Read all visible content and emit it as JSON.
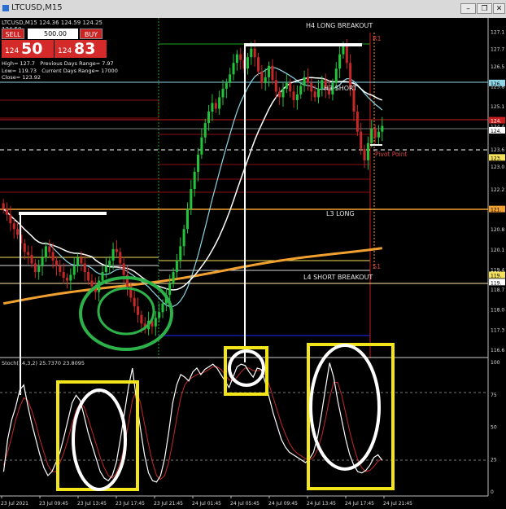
{
  "window": {
    "title": "LTCUSD,M15"
  },
  "trade_panel": {
    "symbol_bar": "LTCUSD,M15  124.36 124.59 124.25 124.50",
    "sell_label": "SELL",
    "buy_label": "BUY",
    "volume": "500.00",
    "sell_small": "124",
    "sell_big": "50",
    "buy_small": "124",
    "buy_big": "83"
  },
  "info": {
    "high": "High= 127.7",
    "low": "Low= 119.73",
    "close": "Close= 123.92",
    "prev_range": "Previous Days Range= 7.97",
    "curr_range": "Current Days Range= 17000"
  },
  "stoch_label": "Stoch(14,3,2) 25.7370 23.8095",
  "chart_data": {
    "type": "candlestick",
    "symbol": "LTCUSD",
    "timeframe": "M15",
    "price_axis": {
      "ticks": [
        "127.1",
        "127.7",
        "126.5",
        "125.8",
        "125.1",
        "124.4",
        "123.6",
        "123.0",
        "122.2",
        "121.5",
        "120.8",
        "120.1",
        "119.4",
        "118.7",
        "118.0",
        "117.3",
        "116.6"
      ],
      "ylim": [
        116.4,
        128.0
      ]
    },
    "price_markers": [
      {
        "label": "126.",
        "value": 125.9,
        "color": "#8fd6e8"
      },
      {
        "label": "124.",
        "value": 124.6,
        "color": "#c81e1e"
      },
      {
        "label": "124.",
        "value": 124.25,
        "color": "#ffffff"
      },
      {
        "label": "123.",
        "value": 123.3,
        "color": "#f5e15b"
      },
      {
        "label": "121.",
        "value": 121.5,
        "color": "#f0a030"
      },
      {
        "label": "119.",
        "value": 119.2,
        "color": "#f5e15b"
      },
      {
        "label": "119.",
        "value": 118.95,
        "color": "#ffffff"
      }
    ],
    "x_ticks": [
      "23 Jul 2021",
      "23 Jul 09:45",
      "23 Jul 13:45",
      "23 Jul 17:45",
      "23 Jul 21:45",
      "24 Jul 01:45",
      "24 Jul 05:45",
      "24 Jul 09:45",
      "24 Jul 13:45",
      "24 Jul 17:45",
      "24 Jul 21:45"
    ],
    "levels": [
      {
        "label": "H4 LONG BREAKOUT",
        "value": 127.6
      },
      {
        "label": "H3 SHORT",
        "value": 125.85
      },
      {
        "label": "Pivot Point",
        "value": 123.3
      },
      {
        "label": "L3 LONG",
        "value": 121.5
      },
      {
        "label": "L4 SHORT BREAKOUT",
        "value": 118.95
      },
      {
        "label": "R1",
        "value": 127.5
      },
      {
        "label": "S1",
        "value": 119.2
      }
    ],
    "closes": [
      121.5,
      121.3,
      121.0,
      120.8,
      120.6,
      120.3,
      120.0,
      119.9,
      119.6,
      119.3,
      119.5,
      119.8,
      120.2,
      120.0,
      119.7,
      119.5,
      119.3,
      119.1,
      119.0,
      119.2,
      119.5,
      119.8,
      119.6,
      119.3,
      119.0,
      118.8,
      118.6,
      119.0,
      119.3,
      119.5,
      119.7,
      120.1,
      120.0,
      119.6,
      119.2,
      118.8,
      118.4,
      118.1,
      117.8,
      117.5,
      117.3,
      117.6,
      117.4,
      117.7,
      117.9,
      118.2,
      118.5,
      118.9,
      119.3,
      119.7,
      120.2,
      120.8,
      121.5,
      122.2,
      122.8,
      123.4,
      124.0,
      124.5,
      124.9,
      125.2,
      125.0,
      125.4,
      125.7,
      125.9,
      126.2,
      126.6,
      126.9,
      126.7,
      126.4,
      126.8,
      127.1,
      126.8,
      126.3,
      125.9,
      126.1,
      126.5,
      126.0,
      125.6,
      125.4,
      125.7,
      125.9,
      125.6,
      125.3,
      125.5,
      125.8,
      126.1,
      125.9,
      125.6,
      125.4,
      125.7,
      126.0,
      125.7,
      125.5,
      125.9,
      126.4,
      126.9,
      127.2,
      126.6,
      125.7,
      124.9,
      124.2,
      123.6,
      123.2,
      123.8,
      124.3,
      124.0,
      124.2,
      124.4
    ],
    "stoch_axis": {
      "ticks": [
        "100",
        "75",
        "50",
        "25",
        "0"
      ],
      "ylim": [
        0,
        100
      ]
    },
    "stoch_main": [
      15,
      40,
      55,
      65,
      78,
      82,
      66,
      52,
      40,
      28,
      18,
      12,
      15,
      22,
      30,
      42,
      55,
      68,
      74,
      70,
      58,
      45,
      35,
      25,
      15,
      10,
      8,
      12,
      22,
      40,
      60,
      80,
      95,
      70,
      48,
      28,
      14,
      8,
      7,
      12,
      25,
      45,
      68,
      82,
      90,
      88,
      85,
      92,
      95,
      90,
      94,
      96,
      98,
      95,
      90,
      85,
      80,
      88,
      96,
      98,
      97,
      92,
      88,
      95,
      94,
      84,
      72,
      60,
      50,
      40,
      34,
      30,
      28,
      26,
      24,
      22,
      25,
      30,
      42,
      60,
      80,
      99,
      88,
      70,
      55,
      40,
      28,
      20,
      15,
      14,
      16,
      20,
      26,
      28,
      24
    ],
    "stoch_signal": [
      20,
      30,
      42,
      55,
      65,
      72,
      70,
      62,
      52,
      40,
      30,
      20,
      15,
      15,
      22,
      30,
      40,
      52,
      62,
      68,
      65,
      56,
      46,
      36,
      26,
      18,
      12,
      10,
      14,
      22,
      35,
      52,
      70,
      78,
      68,
      52,
      36,
      22,
      12,
      9,
      12,
      22,
      38,
      56,
      72,
      82,
      86,
      88,
      90,
      91,
      92,
      94,
      96,
      96,
      94,
      90,
      86,
      85,
      88,
      92,
      95,
      95,
      93,
      93,
      93,
      90,
      82,
      72,
      62,
      52,
      44,
      37,
      32,
      29,
      27,
      25,
      24,
      26,
      32,
      42,
      56,
      72,
      84,
      84,
      74,
      60,
      46,
      34,
      24,
      18,
      15,
      16,
      19,
      23,
      25
    ]
  }
}
